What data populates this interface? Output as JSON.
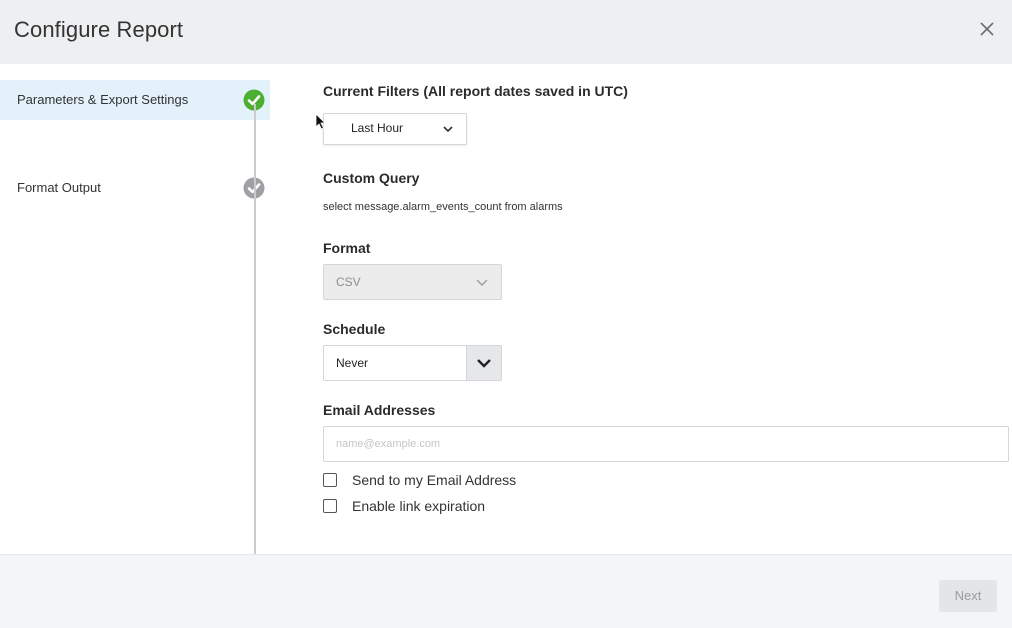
{
  "dialog": {
    "title": "Configure Report",
    "close_icon": "close-icon"
  },
  "sidebar": {
    "steps": [
      {
        "label": "Parameters & Export Settings",
        "status": "complete",
        "icon": "check-circle-icon",
        "active": true
      },
      {
        "label": "Format Output",
        "status": "pending",
        "icon": "check-circle-icon",
        "active": false
      }
    ]
  },
  "main": {
    "filters": {
      "label": "Current Filters (All report dates saved in UTC)",
      "selected": "Last Hour"
    },
    "custom_query": {
      "label": "Custom Query",
      "value": "select message.alarm_events_count from alarms"
    },
    "format": {
      "label": "Format",
      "selected": "CSV",
      "disabled": true
    },
    "schedule": {
      "label": "Schedule",
      "selected": "Never"
    },
    "email": {
      "label": "Email Addresses",
      "placeholder": "name@example.com",
      "value": ""
    },
    "checkboxes": [
      {
        "label": "Send to my Email Address",
        "checked": false
      },
      {
        "label": "Enable link expiration",
        "checked": false
      }
    ]
  },
  "footer": {
    "next_label": "Next",
    "next_disabled": true
  },
  "colors": {
    "header_bg": "#eeeff1",
    "active_step_bg": "#e3f1fb",
    "complete_green": "#4caf32",
    "pending_gray": "#9ea0a3"
  }
}
